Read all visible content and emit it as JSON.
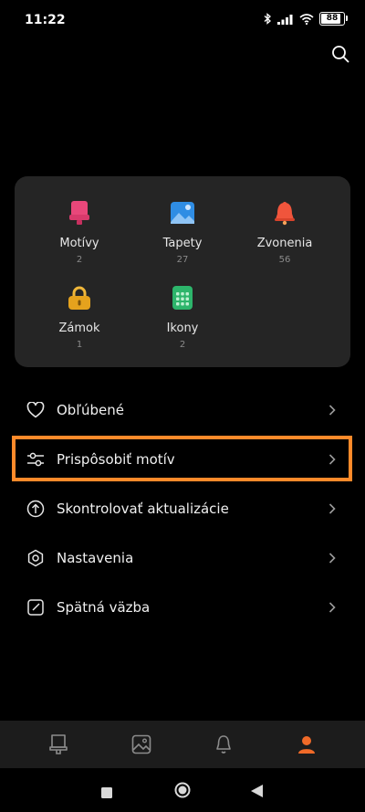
{
  "status_bar": {
    "time": "11:22",
    "battery": "88",
    "battery_level": 0.88
  },
  "categories": [
    {
      "label": "Motívy",
      "count": "2",
      "icon": "theme-icon",
      "color": "#e8477a"
    },
    {
      "label": "Tapety",
      "count": "27",
      "icon": "wallpaper-icon",
      "color": "#2f8de4"
    },
    {
      "label": "Zvonenia",
      "count": "56",
      "icon": "ringtone-icon",
      "color": "#f0553c"
    },
    {
      "label": "Zámok",
      "count": "1",
      "icon": "lock-icon",
      "color": "#e5a21d"
    },
    {
      "label": "Ikony",
      "count": "2",
      "icon": "icons-icon",
      "color": "#2db56b"
    }
  ],
  "menu": [
    {
      "label": "Obľúbené",
      "icon": "heart-icon"
    },
    {
      "label": "Prispôsobiť motív",
      "icon": "sliders-icon"
    },
    {
      "label": "Skontrolovať aktualizácie",
      "icon": "update-icon"
    },
    {
      "label": "Nastavenia",
      "icon": "settings-icon"
    },
    {
      "label": "Spätná väzba",
      "icon": "feedback-icon"
    }
  ],
  "bottom_nav": [
    {
      "icon": "themes-tab-icon",
      "active": false
    },
    {
      "icon": "wallpapers-tab-icon",
      "active": false
    },
    {
      "icon": "ringtones-tab-icon",
      "active": false
    },
    {
      "icon": "profile-tab-icon",
      "active": true
    }
  ],
  "colors": {
    "accent": "#f06a28",
    "highlight": "#ff8a2a",
    "card": "#252525",
    "nav_bg": "#1c1c1c"
  }
}
